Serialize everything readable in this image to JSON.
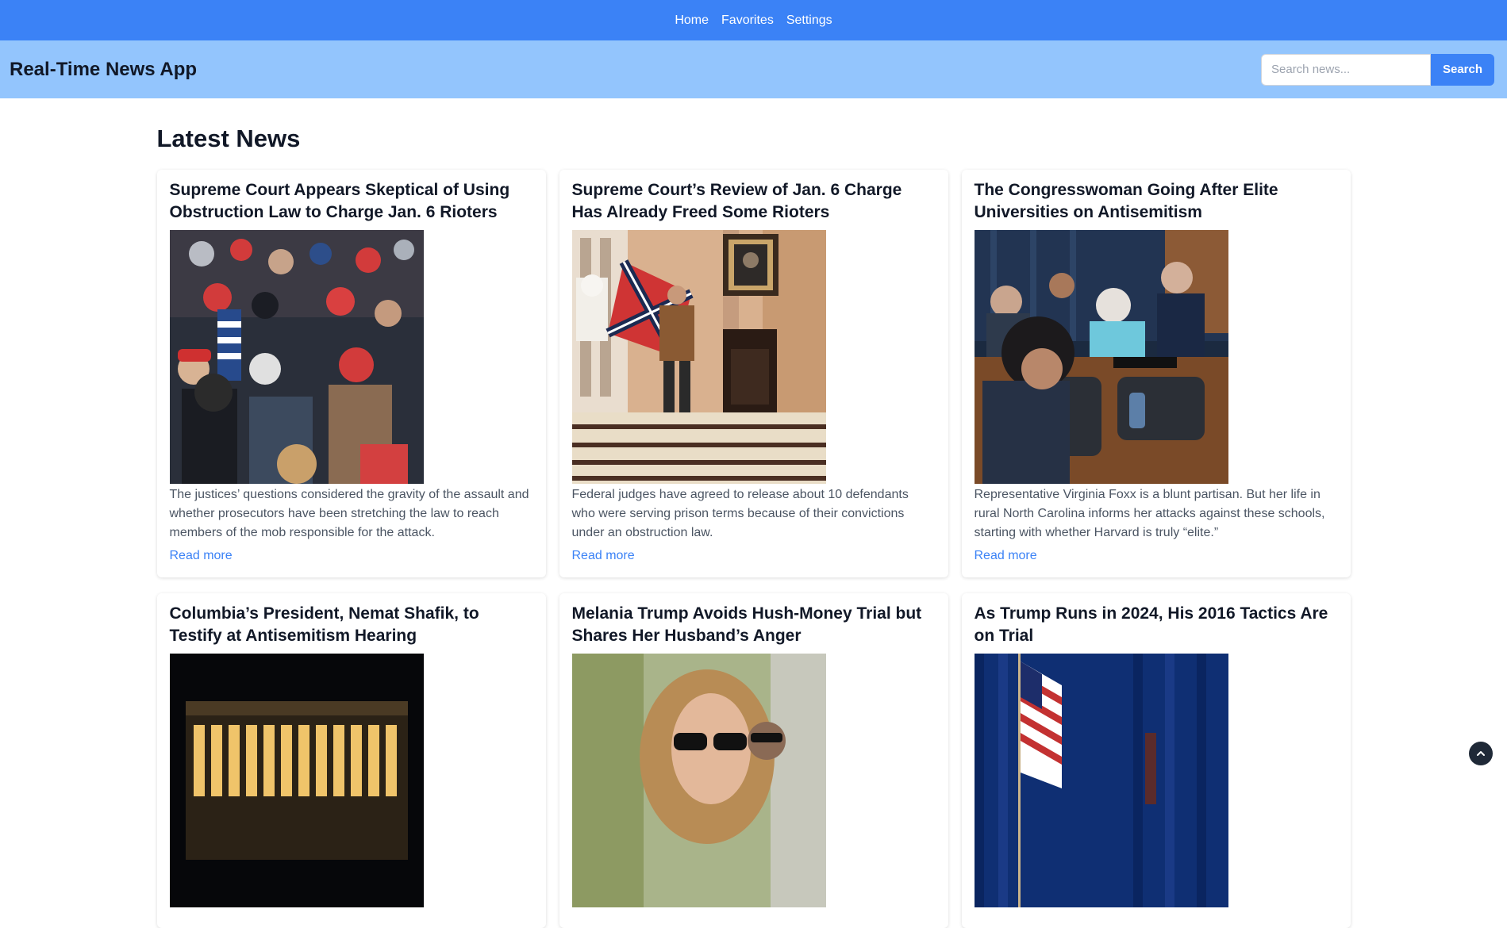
{
  "nav": {
    "items": [
      "Home",
      "Favorites",
      "Settings"
    ]
  },
  "header": {
    "title": "Real-Time News App",
    "search_placeholder": "Search news...",
    "search_button": "Search"
  },
  "main": {
    "section_title": "Latest News",
    "read_more_label": "Read more",
    "articles": [
      {
        "title": "Supreme Court Appears Skeptical of Using Obstruction Law to Charge Jan. 6 Rioters",
        "description": "The justices’ questions considered the gravity of the assault and whether prosecutors have been stretching the law to reach members of the mob responsible for the attack.",
        "image": "crowd-photo"
      },
      {
        "title": "Supreme Court’s Review of Jan. 6 Charge Has Already Freed Some Rioters",
        "description": "Federal judges have agreed to release about 10 defendants who were serving prison terms because of their convictions under an obstruction law.",
        "image": "capitol-interior-photo"
      },
      {
        "title": "The Congresswoman Going After Elite Universities on Antisemitism",
        "description": "Representative Virginia Foxx is a blunt partisan. But her life in rural North Carolina informs her attacks against these schools, starting with whether Harvard is truly “elite.”",
        "image": "hearing-photo"
      },
      {
        "title": "Columbia’s President, Nemat Shafik, to Testify at Antisemitism Hearing",
        "description": "",
        "image": "library-night-photo"
      },
      {
        "title": "Melania Trump Avoids Hush-Money Trial but Shares Her Husband’s Anger",
        "description": "",
        "image": "portrait-photo"
      },
      {
        "title": "As Trump Runs in 2024, His 2016 Tactics Are on Trial",
        "description": "",
        "image": "flag-stage-photo"
      }
    ]
  },
  "colors": {
    "nav_bg": "#3b82f6",
    "header_bg": "#93c5fd",
    "accent": "#3b82f6"
  }
}
